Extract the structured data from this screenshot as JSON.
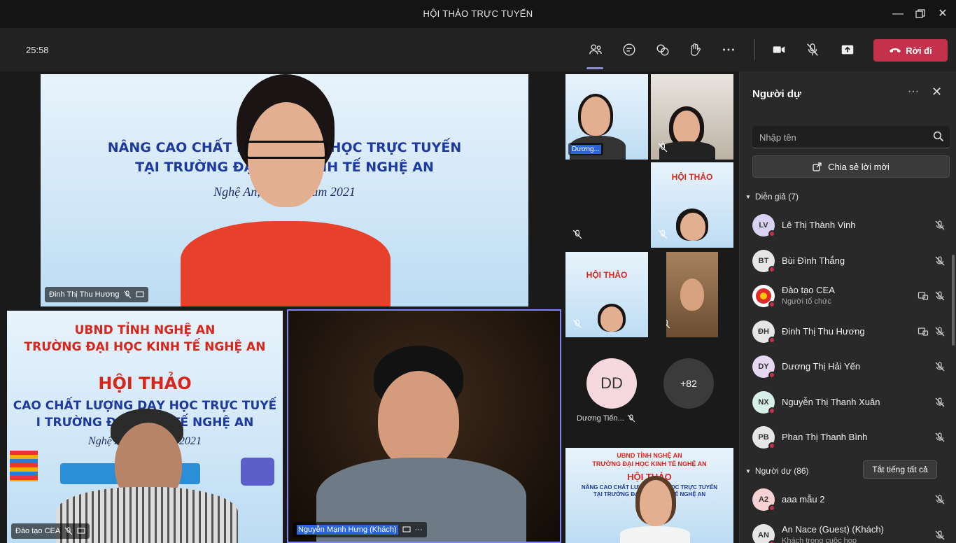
{
  "window": {
    "title": "HỘI THẢO TRỰC TUYẾN"
  },
  "toolbar": {
    "timer": "25:58",
    "leave_label": "Rời đi",
    "icons": [
      "people-icon",
      "chat-icon",
      "reactions-icon",
      "raise-hand-icon",
      "more-icon",
      "camera-icon",
      "mic-off-icon",
      "share-screen-icon"
    ]
  },
  "stage": {
    "main_slide": {
      "title_partial": "HỘI THẢO",
      "line1": "NÂNG CAO CHẤT LƯỢNG DẠY HỌC TRỰC TUYẾN",
      "line2": "TẠI TRƯỜNG ĐẠI HỌC KINH TẾ NGHỆ AN",
      "date": "Nghệ An, ngày … năm 2021",
      "speaker": "Đinh Thị Thu Hương"
    },
    "left_slide": {
      "org1": "UBND TỈNH NGHỆ AN",
      "org2": "TRƯỜNG ĐẠI HỌC KINH TẾ NGHỆ AN",
      "title": "HỘI THẢO",
      "line1": "CAO CHẤT LƯỢNG DẠY HỌC TRỰC TUYẾ",
      "line2": "I TRƯỜNG ĐẠI H    NH TẾ NGHỆ AN",
      "date": "Nghệ An, ngày          năm 2021",
      "speaker": "Đào tạo CEA"
    },
    "center_video": {
      "speaker": "Nguyễn Mạnh Hưng (Khách)"
    },
    "thumb_name": "Dương...",
    "dd_initials": "DD",
    "dd_name": "Dương Tiến...",
    "overflow_count": "+82",
    "br_slide": {
      "org1": "UBND TỈNH NGHỆ AN",
      "org2": "TRƯỜNG ĐẠI HỌC KINH TẾ NGHỆ AN",
      "title": "HỘI THẢO",
      "line1": "NÂNG CAO CHẤT LƯỢNG DẠY HỌC TRỰC TUYẾN",
      "line2": "TẠI TRƯỜNG ĐẠI HỌC KINH TẾ NGHỆ AN"
    }
  },
  "panel": {
    "title": "Người dự",
    "search_placeholder": "Nhập tên",
    "share_label": "Chia sẻ lời mời",
    "presenters_header": "Diễn giả (7)",
    "attendees_header": "Người dự (86)",
    "mute_all_label": "Tắt tiếng tất cả",
    "presenters": [
      {
        "initials": "LV",
        "name": "Lê Thị Thành Vinh",
        "color": "#d9d2f2"
      },
      {
        "initials": "BT",
        "name": "Bùi Đình Thắng",
        "color": "#e6e6e6"
      },
      {
        "initials": "",
        "name": "Đào tạo CEA",
        "sub": "Người tổ chức",
        "color": "#ffffff"
      },
      {
        "initials": "ĐH",
        "name": "Đinh Thị Thu Hương",
        "color": "#e6e6e6"
      },
      {
        "initials": "DY",
        "name": "Dương Thị Hải Yến",
        "color": "#e6d8f0"
      },
      {
        "initials": "NX",
        "name": "Nguyễn Thị Thanh Xuân",
        "color": "#d6efe8"
      },
      {
        "initials": "PB",
        "name": "Phan Thị Thanh Bình",
        "color": "#e6e6e6"
      }
    ],
    "attendees": [
      {
        "initials": "A2",
        "name": "aaa mẫu 2",
        "color": "#f6d2d2"
      },
      {
        "initials": "AN",
        "name": "An Nace (Guest) (Khách)",
        "sub": "Khách trong cuộc họp",
        "color": "#e6e6e6"
      }
    ]
  }
}
